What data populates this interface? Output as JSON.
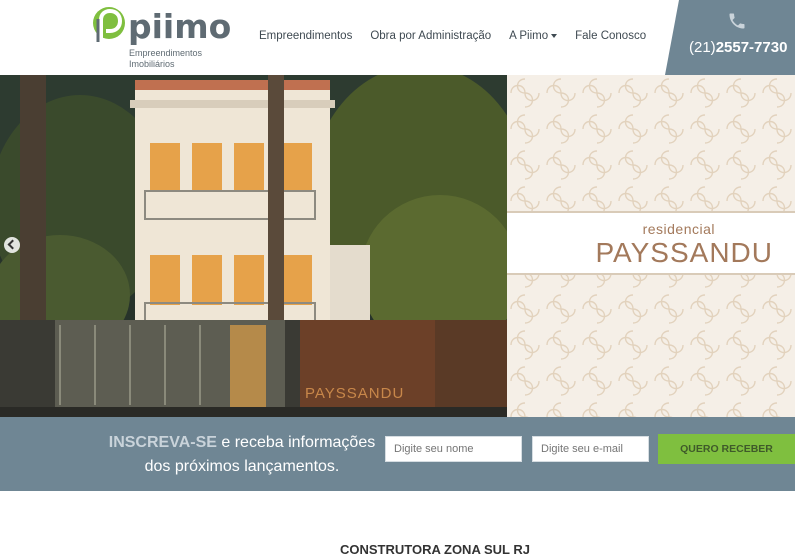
{
  "header": {
    "logo": {
      "name": "piimo",
      "subtitle_line1": "Empreendimentos",
      "subtitle_line2": "Imobiliários"
    },
    "nav": [
      {
        "label": "Empreendimentos",
        "has_dropdown": false
      },
      {
        "label": "Obra por Administração",
        "has_dropdown": false
      },
      {
        "label": "A Piimo",
        "has_dropdown": true
      },
      {
        "label": "Fale Conosco",
        "has_dropdown": false
      }
    ],
    "phone": {
      "area": "(21)",
      "number": "2557-7730",
      "icon": "phone-icon"
    }
  },
  "hero": {
    "brand_small": "residencial",
    "brand_big": "PAYSSANDU",
    "sign_text": "PAYSSANDU",
    "prev_icon": "chevron-left-icon"
  },
  "subscribe": {
    "strong": "INSCREVA-SE",
    "rest_line1": " e receba informações",
    "line2": "dos próximos lançamentos.",
    "name_placeholder": "Digite seu nome",
    "email_placeholder": "Digite seu e-mail",
    "button_label": "QUERO RECEBER"
  },
  "section": {
    "title": "CONSTRUTORA ZONA SUL RJ"
  },
  "colors": {
    "header_phone_bg": "#6f8694",
    "subscribe_bg": "#6f8694",
    "button_green": "#7fbf3f",
    "brand_gold": "#a3795b",
    "logo_green": "#7fbf3f",
    "logo_gray": "#5f6b73"
  }
}
